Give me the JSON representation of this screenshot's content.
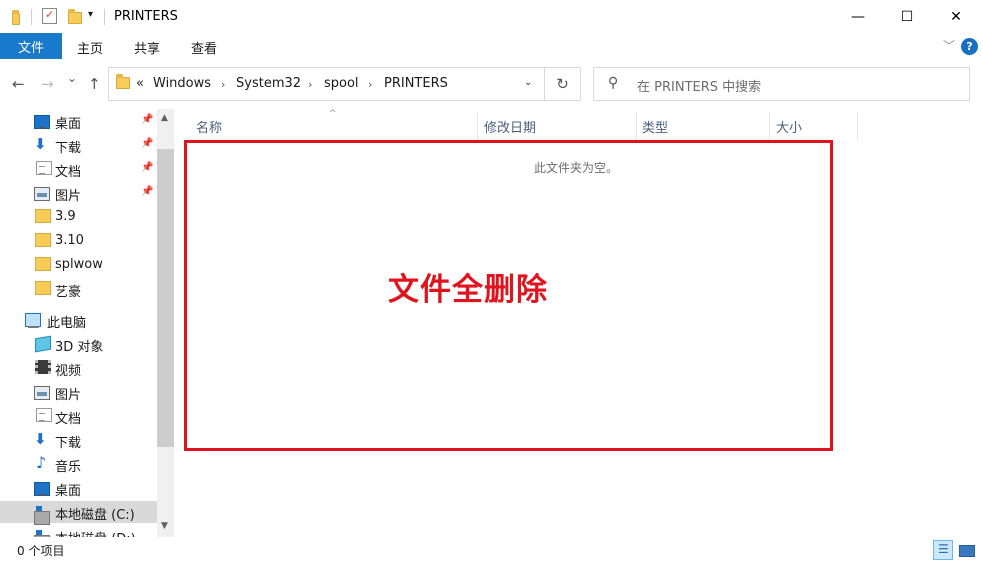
{
  "window": {
    "title": "PRINTERS",
    "minimize": "—",
    "maximize": "☐",
    "close": "✕"
  },
  "ribbon": {
    "file_tab": "文件",
    "tabs": [
      "主页",
      "共享",
      "查看"
    ],
    "expand_icon": "﹀",
    "help_icon": "?"
  },
  "navigation": {
    "back": "←",
    "forward": "→",
    "recent": "⌄",
    "up": "↑",
    "overflow": "«",
    "breadcrumbs": [
      "Windows",
      "System32",
      "spool",
      "PRINTERS"
    ],
    "separator": "›",
    "dropdown": "⌄",
    "refresh": "↻"
  },
  "search": {
    "placeholder": "在 PRINTERS 中搜索",
    "icon": "⚲"
  },
  "sidebar": {
    "quick_access": [
      {
        "label": "桌面",
        "icon": "desktop-icon",
        "pinned": true
      },
      {
        "label": "下载",
        "icon": "download-icon",
        "pinned": true
      },
      {
        "label": "文档",
        "icon": "document-icon",
        "pinned": true
      },
      {
        "label": "图片",
        "icon": "pictures-icon",
        "pinned": true
      },
      {
        "label": "3.9",
        "icon": "folder-icon",
        "pinned": false
      },
      {
        "label": "3.10",
        "icon": "folder-icon",
        "pinned": false
      },
      {
        "label": "splwow",
        "icon": "folder-icon",
        "pinned": false
      },
      {
        "label": "艺豪",
        "icon": "folder-icon",
        "pinned": false
      }
    ],
    "this_pc": "此电脑",
    "pc_items": [
      {
        "label": "3D 对象",
        "icon": "3d-objects-icon"
      },
      {
        "label": "视频",
        "icon": "video-icon"
      },
      {
        "label": "图片",
        "icon": "pictures-icon"
      },
      {
        "label": "文档",
        "icon": "document-icon"
      },
      {
        "label": "下载",
        "icon": "download-icon"
      },
      {
        "label": "音乐",
        "icon": "music-icon"
      },
      {
        "label": "桌面",
        "icon": "desktop-icon"
      },
      {
        "label": "本地磁盘 (C:)",
        "icon": "drive-icon"
      },
      {
        "label": "本地磁盘 (D:)",
        "icon": "drive-icon"
      }
    ],
    "pin_glyph": "📌"
  },
  "columns": {
    "name": "名称",
    "modified": "修改日期",
    "type": "类型",
    "size": "大小",
    "sort_indicator": "^"
  },
  "content": {
    "empty_message": "此文件夹为空。"
  },
  "annotation": {
    "text": "文件全删除",
    "color": "#e0141e"
  },
  "status": {
    "item_count": "0 个项目"
  },
  "colors": {
    "accent": "#1979ca",
    "selection": "#cce8ff"
  }
}
